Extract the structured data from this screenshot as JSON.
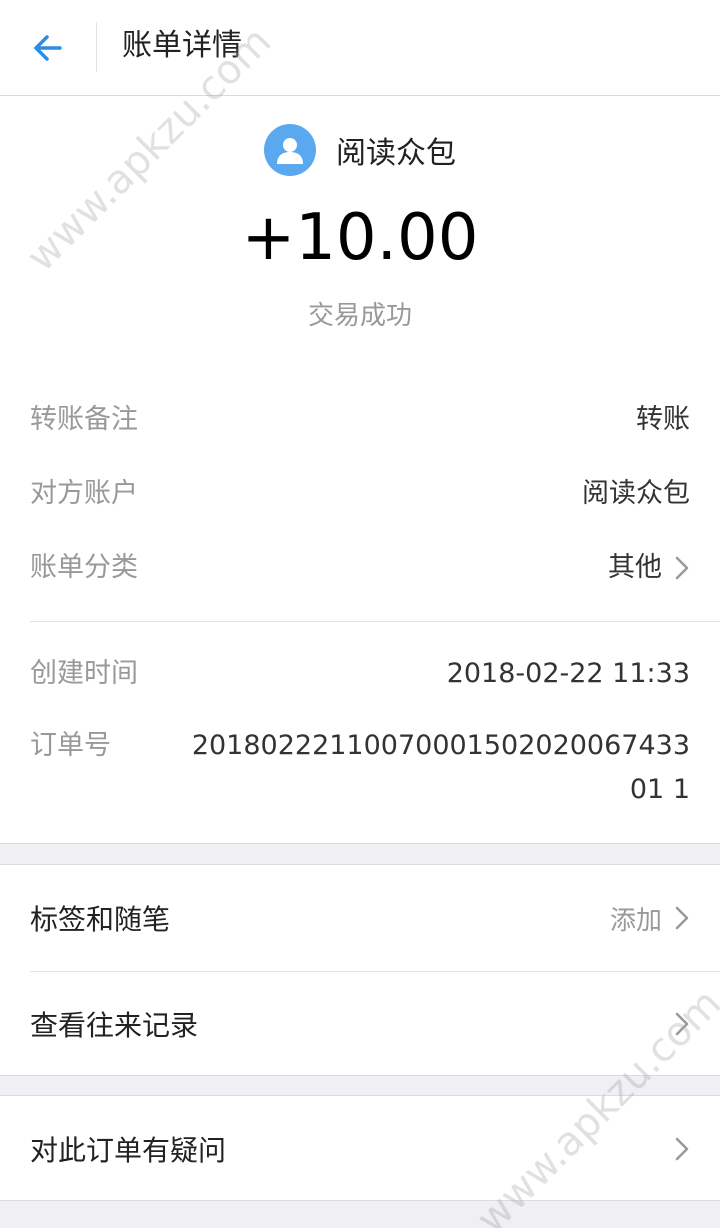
{
  "header": {
    "title": "账单详情",
    "back_icon": "arrow-left-icon"
  },
  "payee": {
    "name": "阅读众包",
    "avatar_icon": "user-avatar-icon",
    "avatar_color": "#5aa9f0"
  },
  "amount": "+10.00",
  "status": "交易成功",
  "details": {
    "remark": {
      "label": "转账备注",
      "value": "转账"
    },
    "account": {
      "label": "对方账户",
      "value": "阅读众包"
    },
    "category": {
      "label": "账单分类",
      "value": "其他"
    },
    "created": {
      "label": "创建时间",
      "value": "2018-02-22 11:33"
    },
    "order": {
      "label": "订单号",
      "value": "2018022211007000150202006743301 1"
    }
  },
  "actions": {
    "tags": {
      "label": "标签和随笔",
      "hint": "添加"
    },
    "history": {
      "label": "查看往来记录"
    },
    "question": {
      "label": "对此订单有疑问"
    }
  },
  "watermark": "www.apkzu.com",
  "colors": {
    "accent": "#2d8de6",
    "background": "#efeff4"
  }
}
